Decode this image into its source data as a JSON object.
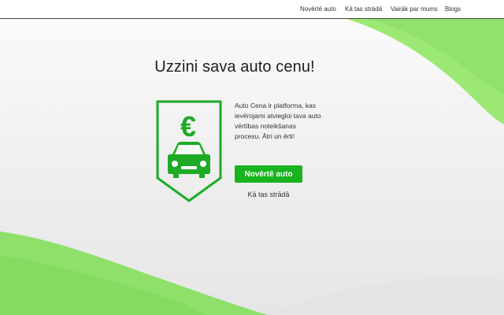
{
  "nav": {
    "items": [
      {
        "label": "Novērtē auto"
      },
      {
        "label": "Kā tas strādā"
      },
      {
        "label": "Vairāk par mums"
      },
      {
        "label": "Blogs"
      }
    ]
  },
  "hero": {
    "title": "Uzzini sava auto cenu!",
    "badge_symbol": "€",
    "description": "Auto Cena ir platforma, kas ievērojami atviegloi tava auto vērtības noteikšanas procesu. Ātri un ērti!",
    "cta_label": "Novērtē auto",
    "secondary_link": "Kā tas strādā"
  },
  "colors": {
    "accent_green": "#18b31f",
    "wave_green": "#8ee06a"
  },
  "icons": [
    "euro-icon",
    "car-icon"
  ]
}
